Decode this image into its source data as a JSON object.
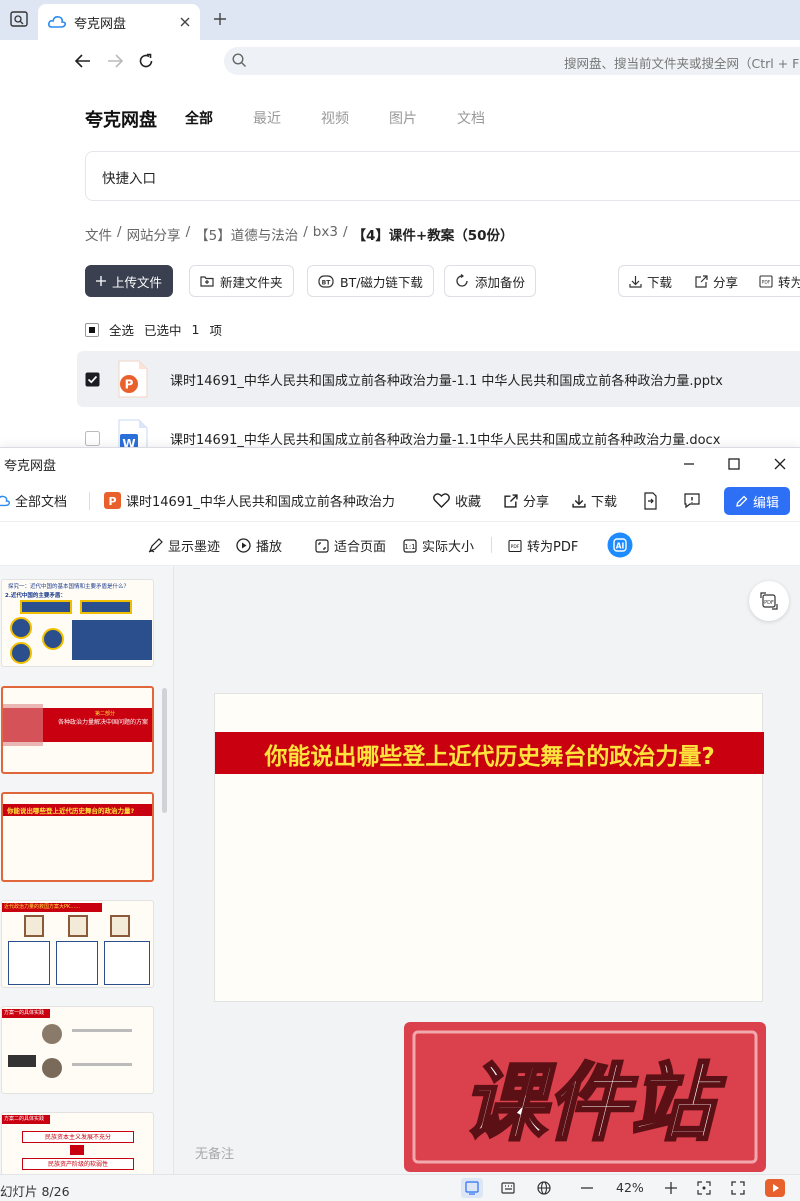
{
  "browser": {
    "tab_title": "夸克网盘",
    "address_placeholder": "搜网盘、搜当前文件夹或搜全网（Ctrl + F）"
  },
  "drive": {
    "logo": "夸克网盘",
    "tabs": [
      {
        "label": "全部",
        "active": true
      },
      {
        "label": "最近",
        "active": false
      },
      {
        "label": "视频",
        "active": false
      },
      {
        "label": "图片",
        "active": false
      },
      {
        "label": "文档",
        "active": false
      }
    ],
    "quick_entry": "快捷入口",
    "breadcrumb": [
      "文件",
      "网站分享",
      "【5】道德与法治",
      "bx3",
      "【4】课件+教案（50份）"
    ],
    "toolbar": {
      "upload": "上传文件",
      "new_folder": "新建文件夹",
      "bt_download": "BT/磁力链下载",
      "add_backup": "添加备份",
      "download": "下载",
      "share": "分享",
      "convert": "转为"
    },
    "selection": {
      "select_all": "全选",
      "selected_text": "已选中",
      "selected_count": "1",
      "unit": "项"
    },
    "files": [
      {
        "name": "课时14691_中华人民共和国成立前各种政治力量-1.1 中华人民共和国成立前各种政治力量.pptx",
        "type": "pptx",
        "checked": true
      },
      {
        "name": "课时14691_中华人民共和国成立前各种政治力量-1.1中华人民共和国成立前各种政治力量.docx",
        "type": "docx",
        "checked": false
      }
    ]
  },
  "viewer": {
    "window_title": "夸克网盘",
    "all_docs": "全部文档",
    "doc_title": "课时14691_中华人民共和国成立前各种政治力",
    "actions": {
      "favorite": "收藏",
      "share": "分享",
      "download": "下载",
      "edit": "编辑"
    },
    "tools": {
      "ink": "显示墨迹",
      "play": "播放",
      "fit_page": "适合页面",
      "actual_size": "实际大小",
      "to_pdf": "转为PDF"
    },
    "slide_title": "你能说出哪些登上近代历史舞台的政治力量?",
    "notes": "无备注",
    "status": {
      "slide_counter": "幻灯片 8/26",
      "zoom": "42%"
    },
    "thumbnails": [
      {
        "title": "探究一：近代中国的基本国情和主要矛盾是什么？",
        "sub": "2.近代中国的主要矛盾："
      },
      {
        "title": "第二部分",
        "sub": "各种政治力量解决中国问题的方案"
      },
      {
        "title": "你能说出哪些登上近代历史舞台的政治力量?"
      },
      {
        "title": "近代政治力量的救国方案大PK……"
      },
      {
        "title": "方案一的具体实践"
      },
      {
        "title": "方案二的具体实践",
        "sub1": "民族资本主义发展不充分",
        "sub2": "民族资产阶级的软弱性"
      }
    ],
    "watermark": "课件站"
  },
  "colors": {
    "accent": "#2d6ff5",
    "slide_red": "#c8000f",
    "slide_yellow": "#ffe33d",
    "stamp": "#d9323e"
  }
}
